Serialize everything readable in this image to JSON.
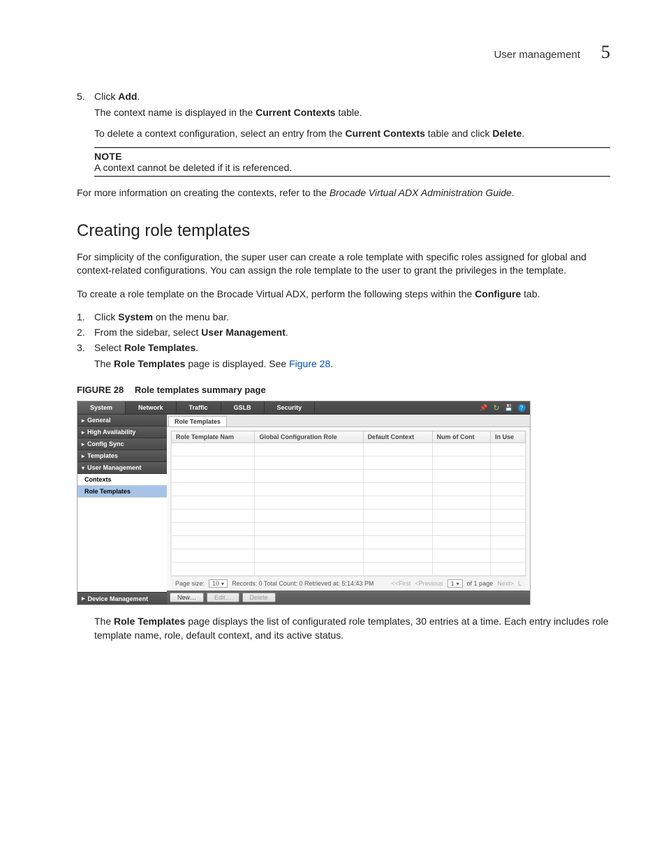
{
  "header": {
    "title": "User management",
    "chapter": "5"
  },
  "step5": {
    "num": "5.",
    "text_prefix": "Click ",
    "bold": "Add",
    "text_suffix": ".",
    "line2_prefix": "The context name is displayed in the ",
    "line2_bold": "Current Contexts",
    "line2_suffix": " table.",
    "line3_prefix": "To delete a context configuration, select an entry from the ",
    "line3_bold": "Current Contexts",
    "line3_mid": " table and click ",
    "line3_bold2": "Delete",
    "line3_suffix": "."
  },
  "note": {
    "title": "NOTE",
    "body": "A context cannot be deleted if it is referenced."
  },
  "moreinfo": {
    "prefix": "For more information on creating the contexts, refer to the ",
    "italic": "Brocade Virtual ADX Administration Guide",
    "suffix": "."
  },
  "section_title": "Creating role templates",
  "para1": "For simplicity of the configuration, the super user can create a role template with specific roles assigned for global and context-related configurations. You can assign the role template to the user to grant the privileges in the template.",
  "para2_prefix": "To create a role template on the Brocade Virtual ADX, perform the following steps within the ",
  "para2_bold": "Configure",
  "para2_suffix": " tab.",
  "steps": [
    {
      "num": "1.",
      "prefix": "Click ",
      "bold": "System",
      "suffix": " on the menu bar."
    },
    {
      "num": "2.",
      "prefix": "From the sidebar, select ",
      "bold": "User Management",
      "suffix": "."
    },
    {
      "num": "3.",
      "prefix": "Select ",
      "bold": "Role Templates",
      "suffix": "."
    }
  ],
  "step3_after_prefix": "The ",
  "step3_after_bold": "Role Templates",
  "step3_after_mid": " page is displayed. See ",
  "step3_after_link": "Figure 28",
  "step3_after_suffix": ".",
  "figure": {
    "label": "FIGURE 28",
    "caption_bold": "Role templates summary",
    "caption_suffix": " page",
    "menubar": [
      "System",
      "Network",
      "Traffic",
      "GSLB",
      "Security"
    ],
    "sidebar": {
      "items": [
        "General",
        "High Availability",
        "Config Sync",
        "Templates",
        "User Management"
      ],
      "subs": [
        "Contexts",
        "Role Templates"
      ],
      "bottom": "Device Management"
    },
    "tab": "Role Templates",
    "columns": [
      "Role Template Nam",
      "Global Configuration Role",
      "Default Context",
      "Num of Cont",
      "In Use"
    ],
    "pager": {
      "pagesize_label": "Page size:",
      "pagesize_value": "10",
      "info": "Records: 0  Total Count: 0  Retrieved at: 5:14:43 PM",
      "first": "<<First",
      "prev": "<Previous",
      "page": "1",
      "of": "of 1 page",
      "next": "Next>",
      "last": "L"
    },
    "buttons": [
      "New…",
      "Edit…",
      "Delete"
    ]
  },
  "after_fig_prefix": "The ",
  "after_fig_bold": "Role Templates",
  "after_fig_suffix": " page displays the list of configurated role templates, 30 entries at a time. Each entry includes role template name, role, default context, and its active status."
}
